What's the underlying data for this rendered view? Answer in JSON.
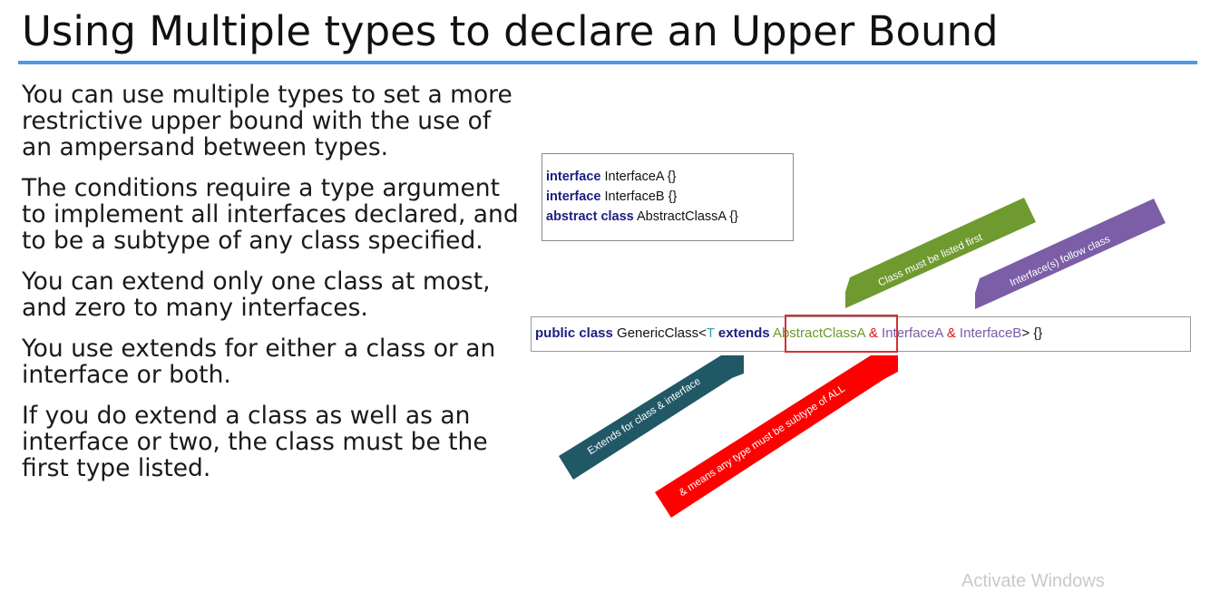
{
  "slide": {
    "title": "Using Multiple types to declare an Upper Bound",
    "bullets": [
      "You can use multiple types to set a more restrictive upper bound with the use of an ampersand between types.",
      "The conditions require a type argument to implement all interfaces declared, and to be a subtype of any class specified.",
      "You can extend only one class at most, and zero to many interfaces.",
      "You use extends for either a class or an interface or both.",
      "If you do extend a class as well as an interface or two, the class must be the first type listed."
    ],
    "declarations": [
      {
        "keyword": "interface",
        "name": " InterfaceA {}"
      },
      {
        "keyword": "interface",
        "name": " InterfaceB {}"
      },
      {
        "keyword": "abstract class",
        "name": " AbstractClassA {}"
      }
    ],
    "code_line": {
      "keyword1": "public class",
      "class_decl": " GenericClass<",
      "type_var": "T",
      "space": " ",
      "extends_kw": "extends",
      "bound_class": " AbstractClassA",
      "amp1": " &",
      "iface1": " InterfaceA",
      "amp2": " &",
      "iface2": " InterfaceB",
      "tail": "> {}"
    },
    "callouts": [
      {
        "text": "Class must be listed first",
        "color": "#6f9a30"
      },
      {
        "text": "Interface(s) follow class",
        "color": "#7b5ea6"
      },
      {
        "text": "Extends for class & interface",
        "color": "#215866"
      },
      {
        "text": "& means any type must be subtype of ALL",
        "color": "#ff0000"
      }
    ],
    "watermark": "Activate Windows"
  }
}
